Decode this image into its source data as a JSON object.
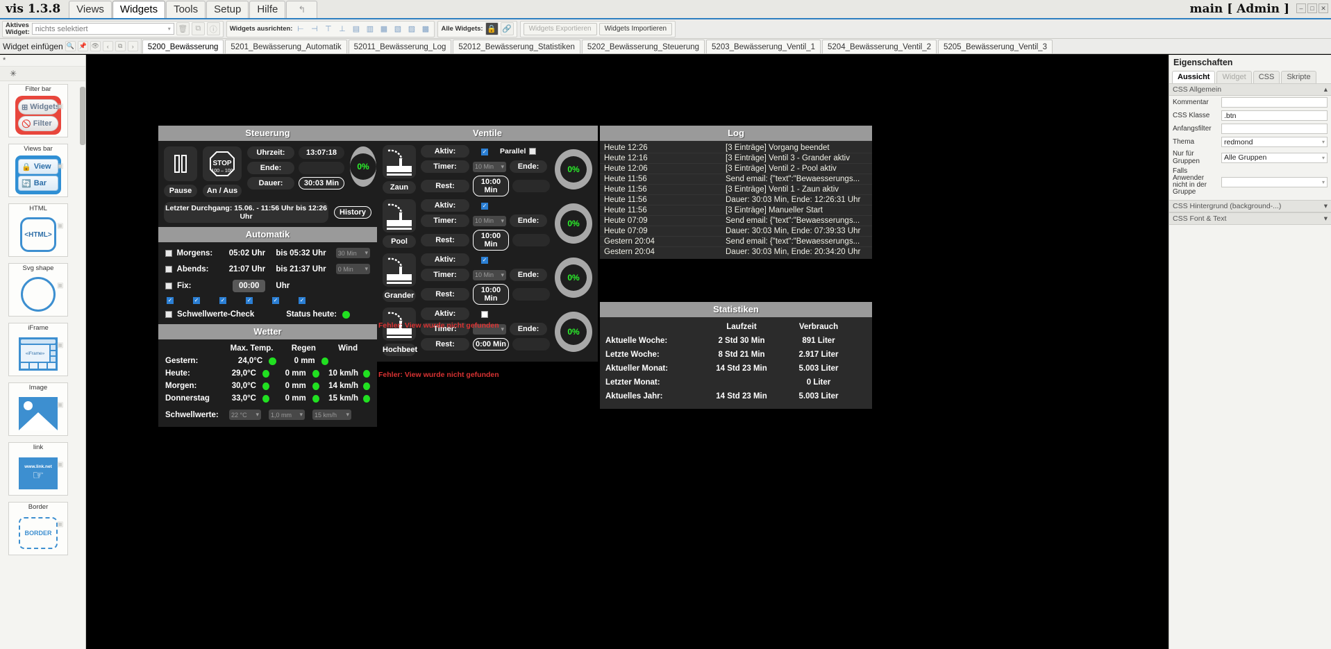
{
  "menubar": {
    "brand": "vis 1.3.8",
    "items": [
      {
        "label": "Views",
        "active": false
      },
      {
        "label": "Widgets",
        "active": true
      },
      {
        "label": "Tools",
        "active": false
      },
      {
        "label": "Setup",
        "active": false
      },
      {
        "label": "Hilfe",
        "active": false
      }
    ],
    "undo_icon": "↰",
    "user": "main [ Admin ]",
    "window_buttons": [
      "–",
      "□",
      "✕"
    ]
  },
  "toolbar": {
    "active_widget_label_line1": "Aktives",
    "active_widget_label_line2": "Widget:",
    "active_widget_value": "nichts selektiert",
    "align_label": "Widgets ausrichten:",
    "all_widgets_label": "Alle Widgets:",
    "export_label": "Widgets Exportieren",
    "import_label": "Widgets Importieren",
    "icons": [
      "trash-icon",
      "copy-icon",
      "info-icon"
    ],
    "align_icons": [
      "align-left-icon",
      "align-center-icon",
      "align-right-icon",
      "align-top-icon",
      "align-middle-icon",
      "align-bottom-icon",
      "distribute-h-icon",
      "distribute-v-icon",
      "same-width-icon",
      "same-height-icon"
    ],
    "all_widget_icons": [
      "lock-icon",
      "link-icon"
    ]
  },
  "tabrow": {
    "insert_label": "Widget einfügen",
    "mini_icons": [
      "search-icon",
      "pin-icon",
      "eye-icon",
      "prev-icon",
      "copy-icon",
      "next-icon"
    ],
    "views": [
      {
        "label": "5200_Bewässerung",
        "active": true
      },
      {
        "label": "5201_Bewässerung_Automatik",
        "active": false
      },
      {
        "label": "52011_Bewässerung_Log",
        "active": false
      },
      {
        "label": "52012_Bewässerung_Statistiken",
        "active": false
      },
      {
        "label": "5202_Bewässerung_Steuerung",
        "active": false
      },
      {
        "label": "5203_Bewässerung_Ventil_1",
        "active": false
      },
      {
        "label": "5204_Bewässerung_Ventil_2",
        "active": false
      },
      {
        "label": "5205_Bewässerung_Ventil_3",
        "active": false
      }
    ]
  },
  "palette": {
    "star1": "*",
    "star2": "✳",
    "cards": [
      {
        "caption": "Filter bar",
        "art": "filterbar",
        "labels": [
          "Widgets",
          "Filter"
        ]
      },
      {
        "caption": "Views bar",
        "art": "viewsbar",
        "labels": [
          "View",
          "Bar"
        ]
      },
      {
        "caption": "HTML",
        "art": "html",
        "labels": [
          "<HTML>"
        ]
      },
      {
        "caption": "Svg shape",
        "art": "svg",
        "labels": []
      },
      {
        "caption": "iFrame",
        "art": "iframe",
        "labels": [
          "«iFrame»"
        ]
      },
      {
        "caption": "Image",
        "art": "image",
        "labels": []
      },
      {
        "caption": "link",
        "art": "link",
        "labels": [
          "www.link.net"
        ]
      },
      {
        "caption": "Border",
        "art": "border",
        "labels": [
          "BORDER"
        ]
      }
    ]
  },
  "steuerung": {
    "title": "Steuerung",
    "pause_button": "Pause",
    "onoff_button": "An / Aus",
    "pause_icon": "pause-icon",
    "stop_icon": "stop-sign-icon",
    "rows": [
      {
        "label": "Uhrzeit:",
        "value": "13:07:18"
      },
      {
        "label": "Ende:",
        "value": ""
      },
      {
        "label": "Dauer:",
        "value": "30:03 Min"
      }
    ],
    "gauge_percent": "0%",
    "last_run": "Letzter Durchgang: 15.06. - 11:56 Uhr bis 12:26 Uhr",
    "history_button": "History"
  },
  "automatik": {
    "title": "Automatik",
    "rows": [
      {
        "checked": false,
        "label": "Morgens:",
        "start": "05:02 Uhr",
        "end": "bis 05:32 Uhr",
        "select": "30 Min"
      },
      {
        "checked": false,
        "label": "Abends:",
        "start": "21:07 Uhr",
        "end": "bis 21:37 Uhr",
        "select": "0 Min"
      }
    ],
    "fix_label": "Fix:",
    "fix_checked": false,
    "fix_value": "00:00",
    "fix_unit": "Uhr",
    "weekday_checks": [
      true,
      true,
      true,
      true,
      true,
      true
    ],
    "threshold_label": "Schwellwerte-Check",
    "threshold_checked": false,
    "status_label": "Status heute:",
    "status_color": "#21e021"
  },
  "wetter": {
    "title": "Wetter",
    "columns": [
      "Max. Temp.",
      "Regen",
      "Wind"
    ],
    "rows": [
      {
        "day": "Gestern:",
        "temp": "24,0°C",
        "temp_ok": true,
        "rain": "0 mm",
        "rain_ok": true,
        "wind": "",
        "wind_ok": false
      },
      {
        "day": "Heute:",
        "temp": "29,0°C",
        "temp_ok": true,
        "rain": "0 mm",
        "rain_ok": true,
        "wind": "10 km/h",
        "wind_ok": true
      },
      {
        "day": "Morgen:",
        "temp": "30,0°C",
        "temp_ok": true,
        "rain": "0 mm",
        "rain_ok": true,
        "wind": "14 km/h",
        "wind_ok": true
      },
      {
        "day": "Donnerstag",
        "temp": "33,0°C",
        "temp_ok": true,
        "rain": "0 mm",
        "rain_ok": true,
        "wind": "15 km/h",
        "wind_ok": true
      }
    ],
    "threshold_row_label": "Schwellwerte:",
    "threshold_values": [
      "22 °C",
      "1,0 mm",
      "15 km/h"
    ]
  },
  "ventile": {
    "title": "Ventile",
    "parallel_label": "Parallel",
    "parallel_checked": false,
    "labels": {
      "aktiv": "Aktiv:",
      "timer": "Timer:",
      "rest": "Rest:",
      "ende": "Ende:"
    },
    "valves": [
      {
        "name": "Zaun",
        "aktiv": true,
        "timer": "10 Min",
        "timer_enabled": false,
        "rest": "10:00 Min",
        "ende": "",
        "gauge": "0%"
      },
      {
        "name": "Pool",
        "aktiv": true,
        "timer": "10 Min",
        "timer_enabled": false,
        "rest": "10:00 Min",
        "ende": "",
        "gauge": "0%"
      },
      {
        "name": "Grander",
        "aktiv": true,
        "timer": "10 Min",
        "timer_enabled": false,
        "rest": "10:00 Min",
        "ende": "",
        "gauge": "0%"
      },
      {
        "name": "Hochbeet",
        "aktiv": false,
        "timer": "",
        "timer_enabled": false,
        "rest": "0:00 Min",
        "ende": "",
        "gauge": "0%"
      }
    ],
    "error_1": "Fehler: View wurde nicht gefunden",
    "error_2": "Fehler: View wurde nicht gefunden"
  },
  "log": {
    "title": "Log",
    "entries": [
      {
        "time": "Heute 12:26",
        "text": "[3 Einträge] Vorgang beendet"
      },
      {
        "time": "Heute 12:16",
        "text": "[3 Einträge] Ventil 3 - Grander aktiv"
      },
      {
        "time": "Heute 12:06",
        "text": "[3 Einträge] Ventil 2 - Pool aktiv"
      },
      {
        "time": "Heute 11:56",
        "text": "Send email: {\"text\":\"Bewaesserungs..."
      },
      {
        "time": "Heute 11:56",
        "text": "[3 Einträge] Ventil 1 - Zaun aktiv"
      },
      {
        "time": "Heute 11:56",
        "text": "Dauer: 30:03 Min, Ende: 12:26:31 Uhr"
      },
      {
        "time": "Heute 11:56",
        "text": "[3 Einträge] Manueller Start"
      },
      {
        "time": "Heute 07:09",
        "text": "Send email: {\"text\":\"Bewaesserungs..."
      },
      {
        "time": "Heute 07:09",
        "text": "Dauer: 30:03 Min, Ende: 07:39:33 Uhr"
      },
      {
        "time": "Gestern 20:04",
        "text": "Send email: {\"text\":\"Bewaesserungs..."
      },
      {
        "time": "Gestern 20:04",
        "text": "Dauer: 30:03 Min, Ende: 20:34:20 Uhr"
      }
    ]
  },
  "statistiken": {
    "title": "Statistiken",
    "columns": [
      "",
      "Laufzeit",
      "Verbrauch"
    ],
    "rows": [
      {
        "label": "Aktuelle Woche:",
        "runtime": "2 Std 30 Min",
        "usage": "891 Liter"
      },
      {
        "label": "Letzte Woche:",
        "runtime": "8 Std 21 Min",
        "usage": "2.917 Liter"
      },
      {
        "label": "Aktueller Monat:",
        "runtime": "14 Std 23 Min",
        "usage": "5.003 Liter"
      },
      {
        "label": "Letzter Monat:",
        "runtime": "",
        "usage": "0 Liter"
      },
      {
        "label": "Aktuelles Jahr:",
        "runtime": "14 Std 23 Min",
        "usage": "5.003 Liter"
      }
    ]
  },
  "props": {
    "title": "Eigenschaften",
    "tabs": [
      {
        "label": "Aussicht",
        "active": true,
        "disabled": false
      },
      {
        "label": "Widget",
        "active": false,
        "disabled": true
      },
      {
        "label": "CSS",
        "active": false,
        "disabled": false
      },
      {
        "label": "Skripte",
        "active": false,
        "disabled": false
      }
    ],
    "groups": [
      {
        "name": "CSS Allgemein",
        "collapsed": false,
        "rows": [
          {
            "key": "Kommentar",
            "value": "",
            "type": "text"
          },
          {
            "key": "CSS Klasse",
            "value": ".btn",
            "type": "text"
          },
          {
            "key": "Anfangsfilter",
            "value": "",
            "type": "text"
          },
          {
            "key": "Thema",
            "value": "redmond",
            "type": "select"
          },
          {
            "key": "Nur für Gruppen",
            "value": "Alle Gruppen",
            "type": "select"
          },
          {
            "key": "Falls Anwender nicht in der Gruppe",
            "value": "",
            "type": "select"
          }
        ]
      },
      {
        "name": "CSS Hintergrund (background-...)",
        "collapsed": true,
        "rows": []
      },
      {
        "name": "CSS Font & Text",
        "collapsed": true,
        "rows": []
      }
    ]
  }
}
